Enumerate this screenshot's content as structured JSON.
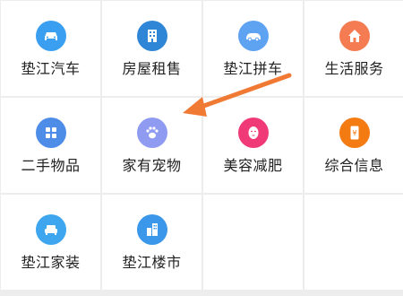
{
  "grid": {
    "items": [
      {
        "label": "垫江汽车",
        "icon": "car-icon",
        "color": "#3a9ff0"
      },
      {
        "label": "房屋租售",
        "icon": "building-icon",
        "color": "#2f86d6"
      },
      {
        "label": "垫江拼车",
        "icon": "car-icon",
        "color": "#5ea2f2"
      },
      {
        "label": "生活服务",
        "icon": "house-icon",
        "color": "#f57c52"
      },
      {
        "label": "二手物品",
        "icon": "four-squares-icon",
        "color": "#4d8de8"
      },
      {
        "label": "家有宠物",
        "icon": "paw-icon",
        "color": "#8e9bf0"
      },
      {
        "label": "美容减肥",
        "icon": "face-mask-icon",
        "color": "#f03a78"
      },
      {
        "label": "综合信息",
        "icon": "phone-yen-icon",
        "color": "#f47a12"
      },
      {
        "label": "垫江家装",
        "icon": "sofa-icon",
        "color": "#3ea6ee"
      },
      {
        "label": "垫江楼市",
        "icon": "buildings-icon",
        "color": "#3a97ea"
      }
    ]
  },
  "annotation": {
    "arrow_color": "#f07a34"
  }
}
